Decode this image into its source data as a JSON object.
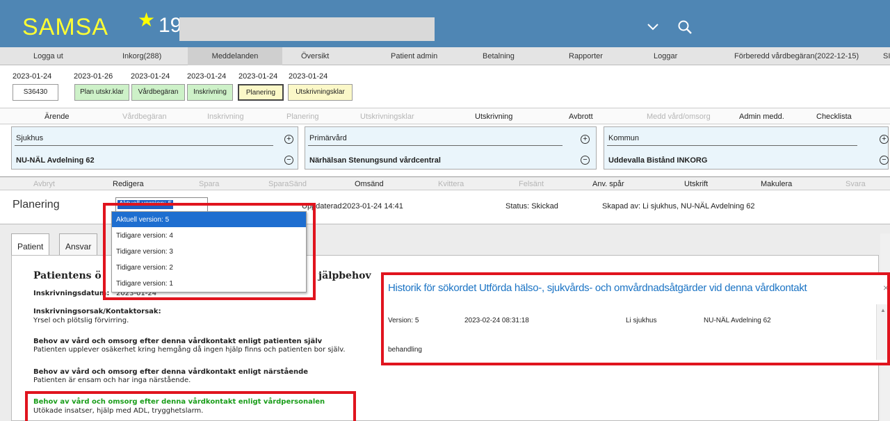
{
  "app": {
    "logo": "SAMSA",
    "count": "19"
  },
  "menu": [
    "Logga ut",
    "Inkorg(288)",
    "Meddelanden",
    "Översikt",
    "Patient admin",
    "Betalning",
    "Rapporter",
    "Loggar",
    "Förberedd vårdbegäran(2022-12-15)",
    "SI"
  ],
  "timeline": {
    "dates": [
      "2023-01-24",
      "2023-01-26",
      "2023-01-24",
      "2023-01-24",
      "2023-01-24",
      "2023-01-24"
    ],
    "chips": [
      "S36430",
      "Plan utskr.klar",
      "Vårdbegäran",
      "Inskrivning",
      "Planering",
      "Utskrivningsklar"
    ]
  },
  "tabs": [
    "Ärende",
    "Vårdbegäran",
    "Inskrivning",
    "Planering",
    "Utskrivningsklar",
    "Utskrivning",
    "Avbrott",
    "Medd vård/omsorg",
    "Admin medd.",
    "Checklista"
  ],
  "units": [
    {
      "title": "Sjukhus",
      "value": "NU-NÄL Avdelning 62"
    },
    {
      "title": "Primärvård",
      "value": "Närhälsan Stenungsund vårdcentral"
    },
    {
      "title": "Kommun",
      "value": "Uddevalla Bistånd INKORG"
    }
  ],
  "actions": [
    "Avbryt",
    "Redigera",
    "Spara",
    "SparaSänd",
    "Omsänd",
    "Kvittera",
    "Felsänt",
    "Anv. spår",
    "Utskrift",
    "Makulera",
    "Svara"
  ],
  "planning": {
    "title": "Planering",
    "selected_version": "Aktuell version: 5",
    "updated_prefix": "Uppdaterad:",
    "updated": "2023-01-24 14:41",
    "status": "Status: Skickad",
    "created": "Skapad av: Li sjukhus, NU-NÄL Avdelning 62"
  },
  "versions": [
    "Aktuell version: 5",
    "Tidigare version: 4",
    "Tidigare version: 3",
    "Tidigare version: 2",
    "Tidigare version: 1"
  ],
  "patient_tabs": [
    "Patient",
    "Ansvar"
  ],
  "patient": {
    "heading_left": "Patientens ö",
    "heading_right": "jälpbehov",
    "admission_label": "Inskrivningsdatum:",
    "admission_date": "2023-01-24",
    "reason_label": "Inskrivningsorsak/Kontaktorsak:",
    "reason_value": "Yrsel och plötslig förvirring.",
    "need_patient_label": "Behov av vård och omsorg efter denna vårdkontakt enligt patienten själv",
    "need_patient_value": "Patienten upplever osäkerhet kring hemgång då ingen hjälp finns och patienten bor själv.",
    "need_relative_label": "Behov av vård och omsorg efter denna vårdkontakt enligt närstående",
    "need_relative_value": "Patienten är ensam och har inga närstående.",
    "need_staff_label": "Behov av vård och omsorg efter denna vårdkontakt enligt vårdpersonalen",
    "need_staff_value": "Utökade insatser, hjälp med ADL, trygghetslarm."
  },
  "history": {
    "title": "Historik för sökordet Utförda hälso-, sjukvårds- och omvårdnadsåtgärder vid denna vårdkontakt",
    "close": "×",
    "version": "Version: 5",
    "timestamp": "2023-02-24 08:31:18",
    "user": "Li sjukhus",
    "unit": "NU-NÄL Avdelning 62",
    "text": "behandling"
  },
  "colors": {
    "header": "#4f86b4",
    "logo": "#ffff33",
    "highlight_red": "#e0141e",
    "green_label": "#1a9d1a",
    "chip_green": "#cdf1c8",
    "chip_yellow": "#fbf8c8"
  }
}
